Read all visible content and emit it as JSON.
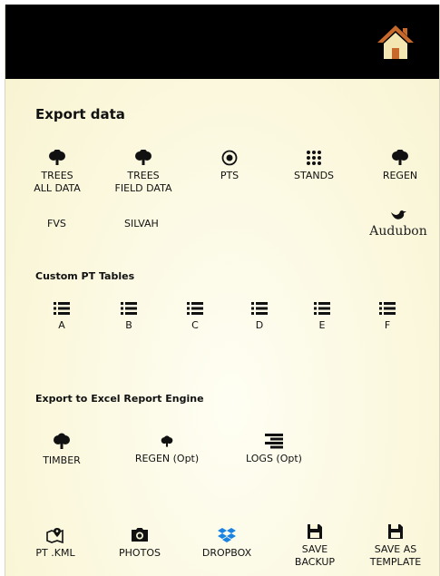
{
  "header": {
    "home_icon": "home-icon"
  },
  "export_data": {
    "title": "Export data",
    "items": [
      {
        "line1": "TREES",
        "line2": "ALL DATA",
        "icon": "tree-icon"
      },
      {
        "line1": "TREES",
        "line2": "FIELD DATA",
        "icon": "tree-icon"
      },
      {
        "line1": "PTS",
        "line2": "",
        "icon": "radio-target-icon"
      },
      {
        "line1": "STANDS",
        "line2": "",
        "icon": "grid-dots-icon"
      },
      {
        "line1": "REGEN",
        "line2": "",
        "icon": "tree-icon"
      }
    ],
    "fvs": "FVS",
    "silvah": "SILVAH",
    "audubon": "Audubon"
  },
  "custom_pt_tables": {
    "title": "Custom PT Tables",
    "items": [
      "A",
      "B",
      "C",
      "D",
      "E",
      "F"
    ]
  },
  "excel_engine": {
    "title": "Export to Excel Report Engine",
    "items": [
      {
        "label": "TIMBER",
        "icon": "tree-icon"
      },
      {
        "label": "REGEN (Opt)",
        "icon": "small-tree-icon"
      },
      {
        "label": "LOGS (Opt)",
        "icon": "align-right-icon"
      }
    ]
  },
  "footer": {
    "items": [
      {
        "line1": "PT .KML",
        "line2": "",
        "icon": "map-pin-icon"
      },
      {
        "line1": "PHOTOS",
        "line2": "",
        "icon": "camera-icon"
      },
      {
        "line1": "DROPBOX",
        "line2": "",
        "icon": "dropbox-icon"
      },
      {
        "line1": "SAVE",
        "line2": "BACKUP",
        "icon": "floppy-icon"
      },
      {
        "line1": "SAVE AS",
        "line2": "TEMPLATE",
        "icon": "floppy-icon"
      }
    ]
  },
  "colors": {
    "topbar": "#000000",
    "home_roof": "#c8692c",
    "home_body": "#f4e6b0",
    "dropbox": "#1a82e2"
  }
}
